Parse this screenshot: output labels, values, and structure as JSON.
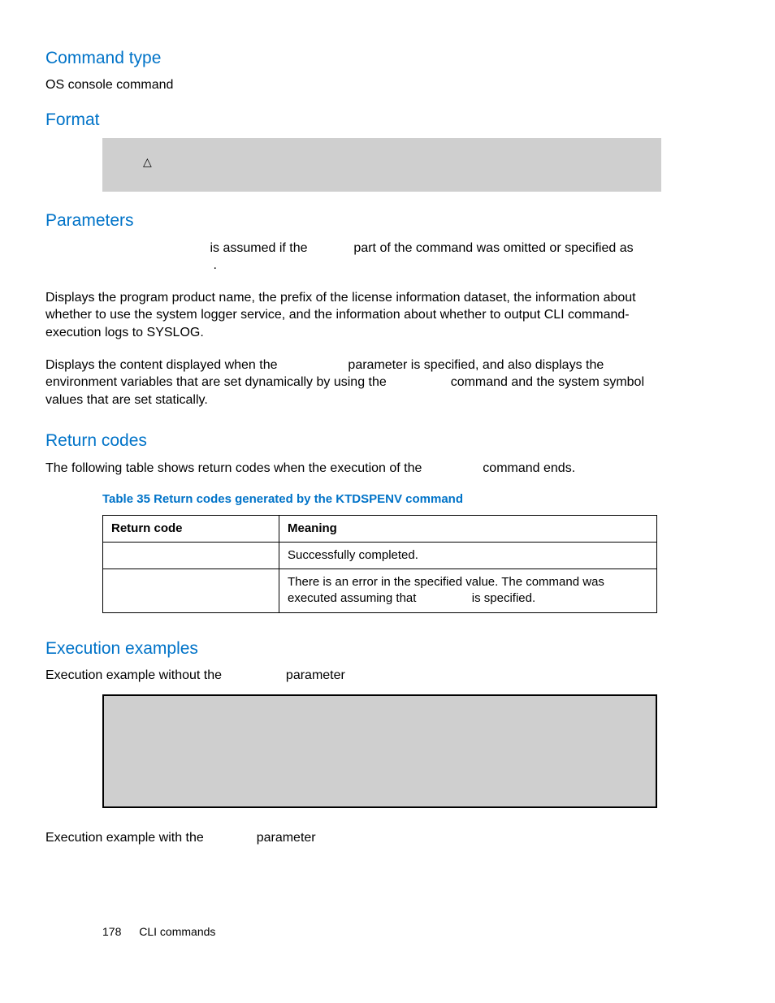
{
  "sections": {
    "command_type": {
      "heading": "Command type",
      "text": "OS console command"
    },
    "format": {
      "heading": "Format",
      "delta": "△"
    },
    "parameters": {
      "heading": "Parameters",
      "line1_a": "is assumed if the",
      "line1_b": "part of the command was omitted or specified as",
      "line1_c": ".",
      "para2": "Displays the program product name, the prefix of the license information dataset, the information about whether to use the system logger service, and the information about whether to output CLI command-execution logs to SYSLOG.",
      "para3_a": "Displays the content displayed when the",
      "para3_b": "parameter is specified, and also displays the environment variables that are set dynamically by using the",
      "para3_c": "command and the system symbol values that are set statically."
    },
    "return_codes": {
      "heading": "Return codes",
      "intro_a": "The following table shows return codes when the execution of the",
      "intro_b": "command ends.",
      "table_caption": "Table 35 Return codes generated by the KTDSPENV command",
      "col1": "Return code",
      "col2": "Meaning",
      "row1_code": "",
      "row1_meaning": "Successfully completed.",
      "row2_code": "",
      "row2_meaning_a": "There is an error in the specified value. The command was executed assuming that",
      "row2_meaning_b": "is specified."
    },
    "execution_examples": {
      "heading": "Execution examples",
      "line1_a": "Execution example without the",
      "line1_b": "parameter",
      "line2_a": "Execution example with the",
      "line2_b": "parameter"
    }
  },
  "footer": {
    "page_number": "178",
    "section": "CLI commands"
  }
}
